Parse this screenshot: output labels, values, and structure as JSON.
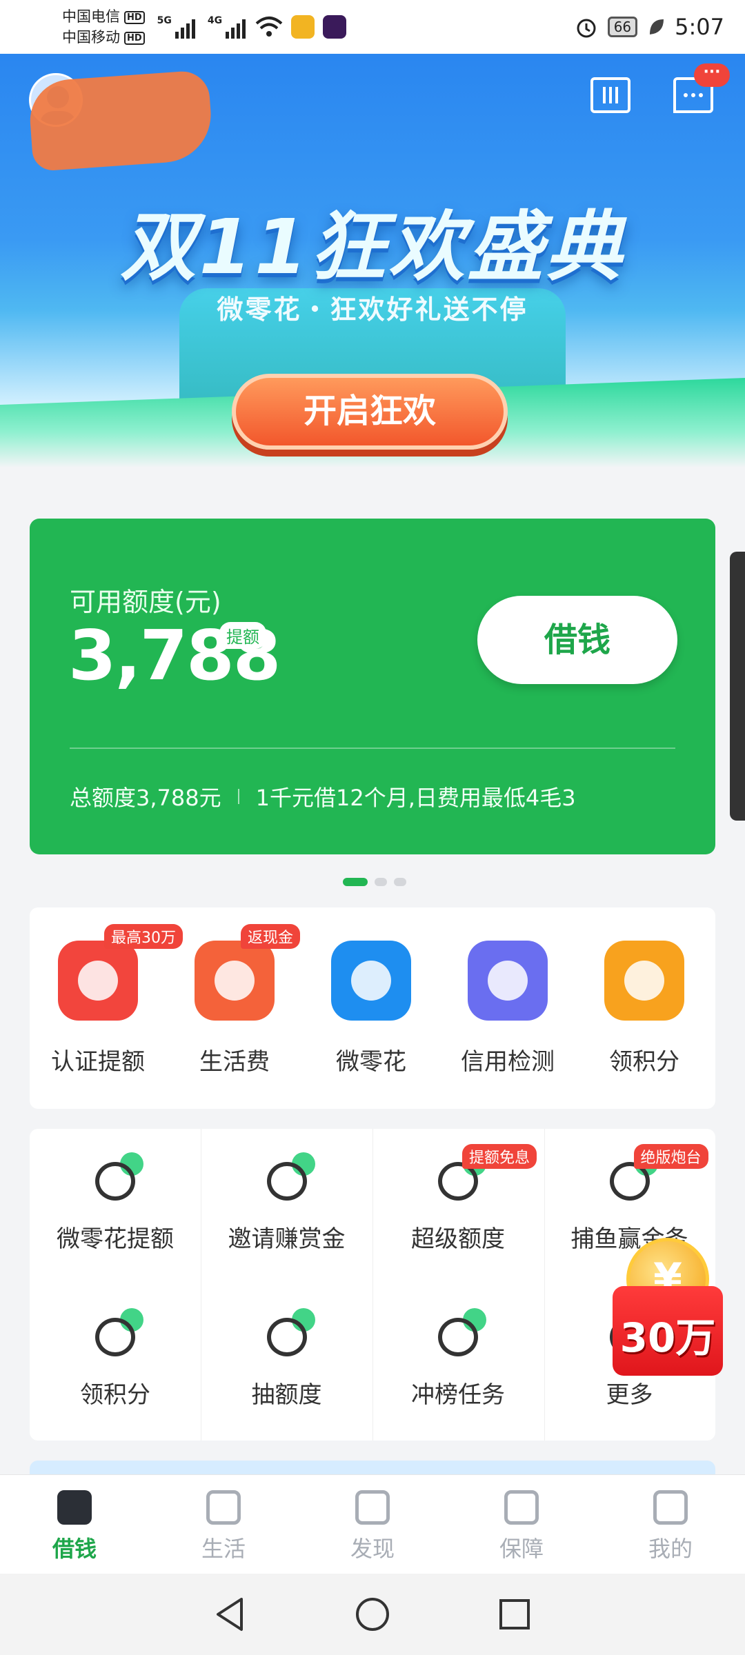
{
  "status_bar": {
    "carrier_1": "中国电信",
    "carrier_2": "中国移动",
    "hd": "HD",
    "net_1": "5G",
    "net_2": "4G",
    "battery": "66",
    "time": "5:07"
  },
  "banner": {
    "title": "双11狂欢盛典",
    "subtitle": "微零花・狂欢好礼送不停",
    "cta_label": "开启狂欢",
    "message_badge": "···"
  },
  "credit_card": {
    "available_label": "可用额度(元)",
    "amount": "3,788",
    "raise_tag": "提额",
    "borrow_button": "借钱",
    "total_text": "总额度3,788元",
    "promo_text": "1千元借12个月,日费用最低4毛3"
  },
  "quick_actions": [
    {
      "label": "认证提额",
      "tag": "最高30万",
      "color": "#f2453d"
    },
    {
      "label": "生活费",
      "tag": "返现金",
      "color": "#f4623a"
    },
    {
      "label": "微零花",
      "tag": "",
      "color": "#1e8ef0"
    },
    {
      "label": "信用检测",
      "tag": "",
      "color": "#6a6ef0"
    },
    {
      "label": "领积分",
      "tag": "",
      "color": "#f8a21e"
    }
  ],
  "grid": [
    {
      "label": "微零花提额",
      "tag": "",
      "icon": "gift-box-icon"
    },
    {
      "label": "邀请赚赏金",
      "tag": "",
      "icon": "invite-icon"
    },
    {
      "label": "超级额度",
      "tag": "提额免息",
      "icon": "diamond-icon"
    },
    {
      "label": "捕鱼赢金条",
      "tag": "绝版炮台",
      "icon": "fish-icon"
    },
    {
      "label": "领积分",
      "tag": "",
      "icon": "star-icon"
    },
    {
      "label": "抽额度",
      "tag": "",
      "icon": "card-icon"
    },
    {
      "label": "冲榜任务",
      "tag": "",
      "icon": "trend-icon"
    },
    {
      "label": "更多",
      "tag": "",
      "icon": "more-icon"
    }
  ],
  "floating_promo": {
    "coin": "¥",
    "amount": "30万"
  },
  "tabbar": [
    {
      "label": "借钱",
      "active": true
    },
    {
      "label": "生活",
      "active": false
    },
    {
      "label": "发现",
      "active": false
    },
    {
      "label": "保障",
      "active": false
    },
    {
      "label": "我的",
      "active": false
    }
  ],
  "colors": {
    "brand_green": "#22b653",
    "tag_red": "#f0443a",
    "banner_blue": "#2a86f0"
  }
}
